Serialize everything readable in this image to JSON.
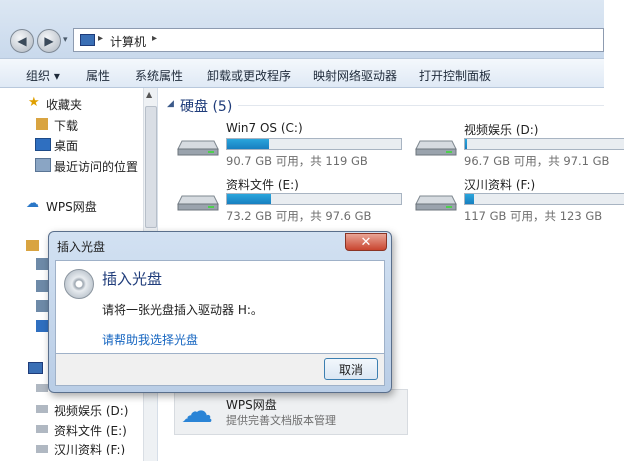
{
  "address": {
    "path": "计算机"
  },
  "toolbar": {
    "items": [
      "组织 ▾",
      "属性",
      "系统属性",
      "卸载或更改程序",
      "映射网络驱动器",
      "打开控制面板"
    ]
  },
  "sidebar": {
    "favorites": "收藏夹",
    "downloads": "下载",
    "desktop": "桌面",
    "recent": "最近访问的位置",
    "wps": "WPS网盘",
    "bottom_items": [
      "视频娱乐 (D:)",
      "资料文件 (E:)",
      "汉川资料 (F:)"
    ]
  },
  "section": {
    "title": "硬盘 (5)"
  },
  "drives": [
    {
      "name": "Win7 OS (C:)",
      "size": "90.7 GB 可用，共 119 GB",
      "used": 0.24
    },
    {
      "name": "视频娱乐 (D:)",
      "size": "96.7 GB 可用，共 97.1 GB",
      "used": 0.01
    },
    {
      "name": "资料文件 (E:)",
      "size": "73.2 GB 可用，共 97.6 GB",
      "used": 0.25
    },
    {
      "name": "汉川资料 (F:)",
      "size": "117 GB 可用，共 123 GB",
      "used": 0.05
    }
  ],
  "dialog": {
    "title": "插入光盘",
    "heading": "插入光盘",
    "message": "请将一张光盘插入驱动器 H:。",
    "link": "请帮助我选择光盘",
    "cancel": "取消",
    "close": "✕"
  },
  "wps_card": {
    "title": "WPS网盘",
    "subtitle": "提供完善文档版本管理"
  },
  "colors": {
    "accent": "#1f3c7a",
    "link": "#1565c0",
    "bar": "#1f8fd0"
  }
}
